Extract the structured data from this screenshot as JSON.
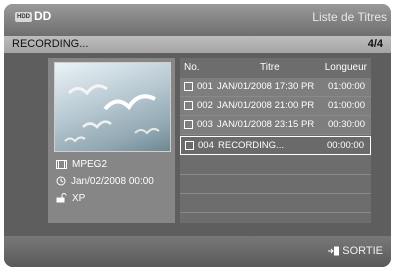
{
  "header": {
    "device_badge": "HDD",
    "title": "DD",
    "screen_title": "Liste de Titres"
  },
  "subheader": {
    "status": "RECORDING...",
    "page": "4/4"
  },
  "preview": {
    "format": "MPEG2",
    "datetime": "Jan/02/2008 00:00",
    "quality": "XP"
  },
  "list": {
    "columns": {
      "no": "No.",
      "title": "Titre",
      "length": "Longueur"
    },
    "rows": [
      {
        "no": "001",
        "title": "JAN/01/2008 17:30 PR",
        "length": "01:00:00"
      },
      {
        "no": "002",
        "title": "JAN/01/2008 21:00 PR",
        "length": "01:00:00"
      },
      {
        "no": "003",
        "title": "JAN/01/2008 23:15 PR",
        "length": "00:30:00"
      },
      {
        "no": "004",
        "title": "RECORDING...",
        "length": "00:00:00"
      }
    ]
  },
  "footer": {
    "exit_label": "SORTIE"
  }
}
